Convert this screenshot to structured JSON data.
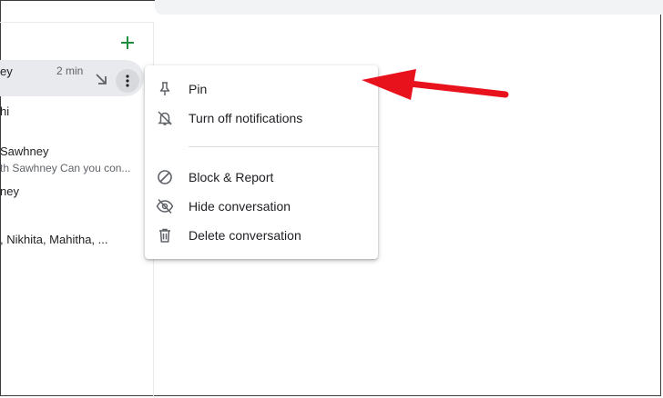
{
  "sidebar": {
    "conversations": [
      {
        "name": "ey",
        "time": "2 min"
      },
      {
        "name": "hi"
      },
      {
        "name": "Sawhney",
        "snippet": "th Sawhney Can you con..."
      },
      {
        "name": "ney"
      },
      {
        "name": ", Nikhita, Mahitha, ..."
      }
    ]
  },
  "menu": {
    "items": [
      {
        "label": "Pin",
        "icon": "pin-icon"
      },
      {
        "label": "Turn off notifications",
        "icon": "notifications-off-icon"
      },
      {
        "label": "Block & Report",
        "icon": "block-icon"
      },
      {
        "label": "Hide conversation",
        "icon": "eye-off-icon"
      },
      {
        "label": "Delete conversation",
        "icon": "trash-icon"
      }
    ]
  },
  "colors": {
    "accent_green": "#1e8e3e",
    "annotation_red": "#e8121d",
    "icon_gray": "#5f6368"
  }
}
